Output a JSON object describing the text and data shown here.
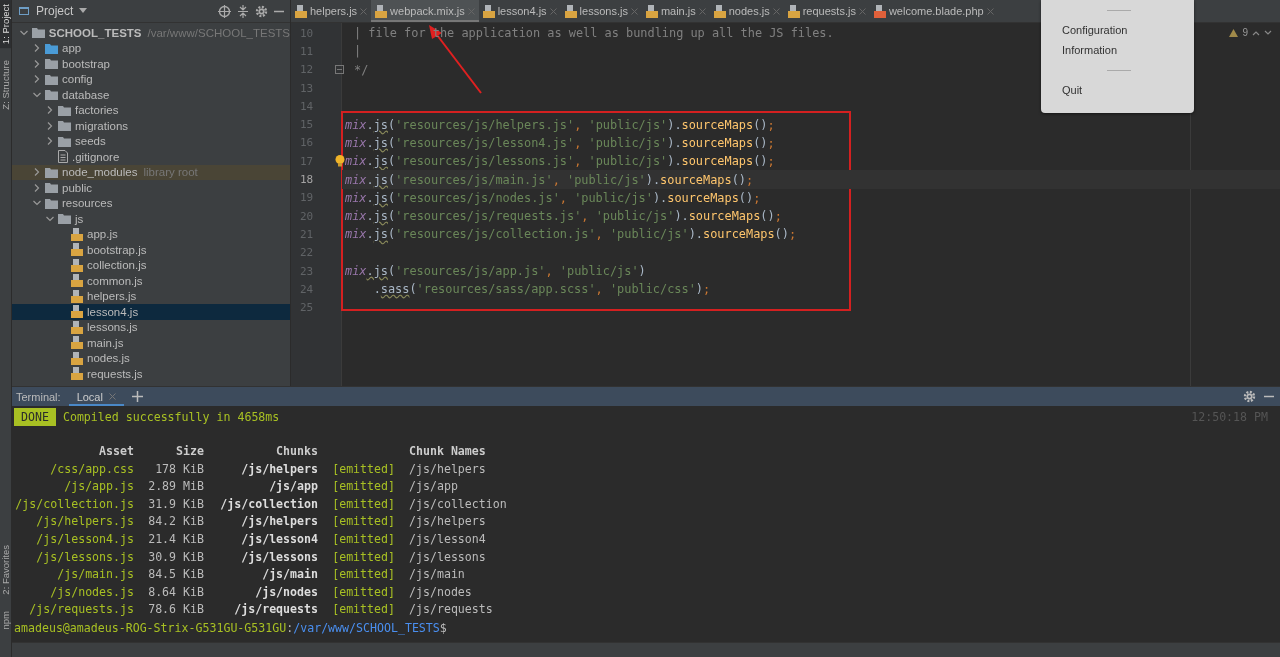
{
  "tool_strip": {
    "top": [
      {
        "label": "1: Project",
        "selected": true
      },
      {
        "label": "Z: Structure",
        "selected": false
      }
    ],
    "bottom": [
      {
        "label": "2: Favorites",
        "selected": false
      },
      {
        "label": "npm",
        "selected": false
      }
    ]
  },
  "project_panel": {
    "title": "Project",
    "tree": [
      {
        "name": "SCHOOL_TESTS",
        "path": "/var/www/SCHOOL_TESTS",
        "kind": "folder",
        "expanded": true,
        "selected": false,
        "children": [
          {
            "name": "app",
            "kind": "source-folder",
            "expanded": false,
            "selected": false
          },
          {
            "name": "bootstrap",
            "kind": "folder",
            "expanded": false,
            "selected": false
          },
          {
            "name": "config",
            "kind": "folder",
            "expanded": false,
            "selected": false
          },
          {
            "name": "database",
            "kind": "folder",
            "expanded": true,
            "selected": false,
            "children": [
              {
                "name": "factories",
                "kind": "folder",
                "expanded": false,
                "selected": false
              },
              {
                "name": "migrations",
                "kind": "folder",
                "expanded": false,
                "selected": false
              },
              {
                "name": "seeds",
                "kind": "folder",
                "expanded": false,
                "selected": false
              },
              {
                "name": ".gitignore",
                "kind": "file",
                "selected": false
              }
            ]
          },
          {
            "name": "node_modules",
            "note": "library root",
            "kind": "library-folder",
            "expanded": false,
            "selected": false
          },
          {
            "name": "public",
            "kind": "folder",
            "expanded": false,
            "selected": false
          },
          {
            "name": "resources",
            "kind": "folder",
            "expanded": true,
            "selected": false,
            "children": [
              {
                "name": "js",
                "kind": "folder",
                "expanded": true,
                "selected": false,
                "children": [
                  {
                    "name": "app.js",
                    "kind": "js-file",
                    "selected": false
                  },
                  {
                    "name": "bootstrap.js",
                    "kind": "js-file",
                    "selected": false
                  },
                  {
                    "name": "collection.js",
                    "kind": "js-file",
                    "selected": false
                  },
                  {
                    "name": "common.js",
                    "kind": "js-file",
                    "selected": false
                  },
                  {
                    "name": "helpers.js",
                    "kind": "js-file",
                    "selected": false
                  },
                  {
                    "name": "lesson4.js",
                    "kind": "js-file",
                    "selected": true
                  },
                  {
                    "name": "lessons.js",
                    "kind": "js-file",
                    "selected": false
                  },
                  {
                    "name": "main.js",
                    "kind": "js-file",
                    "selected": false
                  },
                  {
                    "name": "nodes.js",
                    "kind": "js-file",
                    "selected": false
                  },
                  {
                    "name": "requests.js",
                    "kind": "js-file",
                    "selected": false
                  }
                ]
              }
            ]
          }
        ]
      }
    ]
  },
  "editor": {
    "tabs": [
      {
        "label": "helpers.js",
        "kind": "js",
        "selected": false
      },
      {
        "label": "webpack.mix.js",
        "kind": "js",
        "selected": true
      },
      {
        "label": "lesson4.js",
        "kind": "js",
        "selected": false
      },
      {
        "label": "lessons.js",
        "kind": "js",
        "selected": false
      },
      {
        "label": "main.js",
        "kind": "js",
        "selected": false
      },
      {
        "label": "nodes.js",
        "kind": "js",
        "selected": false
      },
      {
        "label": "requests.js",
        "kind": "js",
        "selected": false
      },
      {
        "label": "welcome.blade.php",
        "kind": "php",
        "selected": false
      }
    ],
    "warnings": "9",
    "lines": [
      {
        "number": "10",
        "current": false,
        "fold": false,
        "bulb": false,
        "segments": [
          {
            "kind": "comment",
            "text": "| file for the application as well as bundling up all the JS files."
          }
        ]
      },
      {
        "number": "11",
        "current": false,
        "fold": false,
        "bulb": false,
        "segments": [
          {
            "kind": "comment",
            "text": "|"
          }
        ]
      },
      {
        "number": "12",
        "current": false,
        "fold": true,
        "bulb": false,
        "segments": [
          {
            "kind": "comment",
            "text": "*/"
          }
        ]
      },
      {
        "number": "13",
        "current": false,
        "fold": false,
        "bulb": false
      },
      {
        "number": "14",
        "current": false,
        "fold": false,
        "bulb": false
      },
      {
        "number": "15",
        "current": false,
        "fold": false,
        "bulb": false,
        "segments": [
          {
            "kind": "obj",
            "text": "mix"
          },
          {
            "kind": "plain",
            "text": "."
          },
          {
            "kind": "warn",
            "text": "js"
          },
          {
            "kind": "plain",
            "text": "("
          },
          {
            "kind": "str",
            "text": "'resources/js/helpers.js'"
          },
          {
            "kind": "punct",
            "text": ", "
          },
          {
            "kind": "str",
            "text": "'public/js'"
          },
          {
            "kind": "plain",
            "text": ")."
          },
          {
            "kind": "method",
            "text": "sourceMaps"
          },
          {
            "kind": "plain",
            "text": "()"
          },
          {
            "kind": "punct",
            "text": ";"
          }
        ]
      },
      {
        "number": "16",
        "current": false,
        "fold": false,
        "bulb": false,
        "segments": [
          {
            "kind": "obj",
            "text": "mix"
          },
          {
            "kind": "plain",
            "text": "."
          },
          {
            "kind": "warn",
            "text": "js"
          },
          {
            "kind": "plain",
            "text": "("
          },
          {
            "kind": "str",
            "text": "'resources/js/lesson4.js'"
          },
          {
            "kind": "punct",
            "text": ", "
          },
          {
            "kind": "str",
            "text": "'public/js'"
          },
          {
            "kind": "plain",
            "text": ")."
          },
          {
            "kind": "method",
            "text": "sourceMaps"
          },
          {
            "kind": "plain",
            "text": "()"
          },
          {
            "kind": "punct",
            "text": ";"
          }
        ]
      },
      {
        "number": "17",
        "current": false,
        "fold": false,
        "bulb": true,
        "segments": [
          {
            "kind": "obj",
            "text": "mix"
          },
          {
            "kind": "plain",
            "text": "."
          },
          {
            "kind": "warn",
            "text": "js"
          },
          {
            "kind": "plain",
            "text": "("
          },
          {
            "kind": "str",
            "text": "'resources/js/lessons.js'"
          },
          {
            "kind": "punct",
            "text": ", "
          },
          {
            "kind": "str",
            "text": "'public/js'"
          },
          {
            "kind": "plain",
            "text": ")."
          },
          {
            "kind": "method",
            "text": "sourceMaps"
          },
          {
            "kind": "plain",
            "text": "()"
          },
          {
            "kind": "punct",
            "text": ";"
          }
        ]
      },
      {
        "number": "18",
        "current": true,
        "fold": false,
        "bulb": false,
        "segments": [
          {
            "kind": "obj",
            "text": "mix"
          },
          {
            "kind": "plain",
            "text": "."
          },
          {
            "kind": "warn",
            "text": "js"
          },
          {
            "kind": "plain",
            "text": "("
          },
          {
            "kind": "str",
            "text": "'resources/js/main.js'"
          },
          {
            "kind": "punct",
            "text": ", "
          },
          {
            "kind": "str",
            "text": "'public/js'"
          },
          {
            "kind": "plain",
            "text": ")."
          },
          {
            "kind": "method",
            "text": "sourceMaps"
          },
          {
            "kind": "plain",
            "text": "()"
          },
          {
            "kind": "punct",
            "text": ";"
          }
        ]
      },
      {
        "number": "19",
        "current": false,
        "fold": false,
        "bulb": false,
        "segments": [
          {
            "kind": "obj",
            "text": "mix"
          },
          {
            "kind": "plain",
            "text": "."
          },
          {
            "kind": "warn",
            "text": "js"
          },
          {
            "kind": "plain",
            "text": "("
          },
          {
            "kind": "str",
            "text": "'resources/js/nodes.js'"
          },
          {
            "kind": "punct",
            "text": ", "
          },
          {
            "kind": "str",
            "text": "'public/js'"
          },
          {
            "kind": "plain",
            "text": ")."
          },
          {
            "kind": "method",
            "text": "sourceMaps"
          },
          {
            "kind": "plain",
            "text": "()"
          },
          {
            "kind": "punct",
            "text": ";"
          }
        ]
      },
      {
        "number": "20",
        "current": false,
        "fold": false,
        "bulb": false,
        "segments": [
          {
            "kind": "obj",
            "text": "mix"
          },
          {
            "kind": "plain",
            "text": "."
          },
          {
            "kind": "warn",
            "text": "js"
          },
          {
            "kind": "plain",
            "text": "("
          },
          {
            "kind": "str",
            "text": "'resources/js/requests.js'"
          },
          {
            "kind": "punct",
            "text": ", "
          },
          {
            "kind": "str",
            "text": "'public/js'"
          },
          {
            "kind": "plain",
            "text": ")."
          },
          {
            "kind": "method",
            "text": "sourceMaps"
          },
          {
            "kind": "plain",
            "text": "()"
          },
          {
            "kind": "punct",
            "text": ";"
          }
        ]
      },
      {
        "number": "21",
        "current": false,
        "fold": false,
        "bulb": false,
        "segments": [
          {
            "kind": "obj",
            "text": "mix"
          },
          {
            "kind": "plain",
            "text": "."
          },
          {
            "kind": "warn",
            "text": "js"
          },
          {
            "kind": "plain",
            "text": "("
          },
          {
            "kind": "str",
            "text": "'resources/js/collection.js'"
          },
          {
            "kind": "punct",
            "text": ", "
          },
          {
            "kind": "str",
            "text": "'public/js'"
          },
          {
            "kind": "plain",
            "text": ")."
          },
          {
            "kind": "method",
            "text": "sourceMaps"
          },
          {
            "kind": "plain",
            "text": "()"
          },
          {
            "kind": "punct",
            "text": ";"
          }
        ]
      },
      {
        "number": "22",
        "current": false,
        "fold": false,
        "bulb": false
      },
      {
        "number": "23",
        "current": false,
        "fold": false,
        "bulb": false,
        "segments": [
          {
            "kind": "obj",
            "text": "mix"
          },
          {
            "kind": "warn",
            "text": ".js"
          },
          {
            "kind": "plain",
            "text": "("
          },
          {
            "kind": "str",
            "text": "'resources/js/app.js'"
          },
          {
            "kind": "punct",
            "text": ", "
          },
          {
            "kind": "str",
            "text": "'public/js'"
          },
          {
            "kind": "plain",
            "text": ")"
          }
        ]
      },
      {
        "number": "24",
        "current": false,
        "fold": false,
        "bulb": false,
        "segments": [
          {
            "kind": "plain",
            "text": "    ."
          },
          {
            "kind": "warn",
            "text": "sass"
          },
          {
            "kind": "plain",
            "text": "("
          },
          {
            "kind": "str",
            "text": "'resources/sass/app.scss'"
          },
          {
            "kind": "punct",
            "text": ", "
          },
          {
            "kind": "str",
            "text": "'public/css'"
          },
          {
            "kind": "plain",
            "text": ")"
          },
          {
            "kind": "punct",
            "text": ";"
          }
        ]
      },
      {
        "number": "25",
        "current": false,
        "fold": false,
        "bulb": false
      }
    ]
  },
  "menu": {
    "items": [
      {
        "kind": "separator"
      },
      {
        "kind": "item",
        "label": "Configuration"
      },
      {
        "kind": "item",
        "label": "Information"
      },
      {
        "kind": "separator"
      },
      {
        "kind": "item",
        "label": "Quit"
      }
    ]
  },
  "terminal": {
    "title": "Terminal:",
    "tabs": [
      {
        "label": "Local",
        "selected": true
      }
    ],
    "badge": "DONE",
    "message": "Compiled successfully in 4658ms",
    "time": "12:50:18 PM",
    "columns": [
      "Asset",
      "Size",
      "Chunks",
      "Chunk Names"
    ],
    "rows": [
      {
        "asset": "/css/app.css",
        "size": "178 KiB",
        "chunks": "/js/helpers",
        "status": "[emitted]",
        "chunk_names": "/js/helpers"
      },
      {
        "asset": "/js/app.js",
        "size": "2.89 MiB",
        "chunks": "/js/app",
        "status": "[emitted]",
        "chunk_names": "/js/app"
      },
      {
        "asset": "/js/collection.js",
        "size": "31.9 KiB",
        "chunks": "/js/collection",
        "status": "[emitted]",
        "chunk_names": "/js/collection"
      },
      {
        "asset": "/js/helpers.js",
        "size": "84.2 KiB",
        "chunks": "/js/helpers",
        "status": "[emitted]",
        "chunk_names": "/js/helpers"
      },
      {
        "asset": "/js/lesson4.js",
        "size": "21.4 KiB",
        "chunks": "/js/lesson4",
        "status": "[emitted]",
        "chunk_names": "/js/lesson4"
      },
      {
        "asset": "/js/lessons.js",
        "size": "30.9 KiB",
        "chunks": "/js/lessons",
        "status": "[emitted]",
        "chunk_names": "/js/lessons"
      },
      {
        "asset": "/js/main.js",
        "size": "84.5 KiB",
        "chunks": "/js/main",
        "status": "[emitted]",
        "chunk_names": "/js/main"
      },
      {
        "asset": "/js/nodes.js",
        "size": "8.64 KiB",
        "chunks": "/js/nodes",
        "status": "[emitted]",
        "chunk_names": "/js/nodes"
      },
      {
        "asset": "/js/requests.js",
        "size": "78.6 KiB",
        "chunks": "/js/requests",
        "status": "[emitted]",
        "chunk_names": "/js/requests"
      }
    ],
    "prompt": {
      "user": "amadeus@amadeus-ROG-Strix-G531GU-G531GU",
      "separator": ":",
      "path": "/var/www/SCHOOL_TESTS",
      "symbol": "$"
    }
  }
}
